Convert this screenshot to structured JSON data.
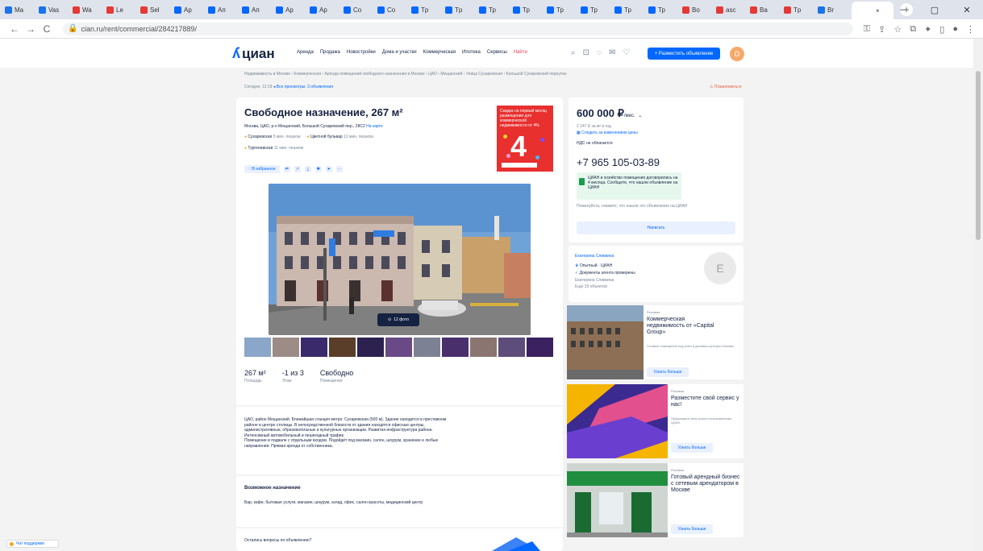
{
  "browser": {
    "tabs": [
      {
        "label": "Ma",
        "color": "#1a73e8"
      },
      {
        "label": "Vas",
        "color": "#1a73e8"
      },
      {
        "label": "Wa",
        "color": "#e53935"
      },
      {
        "label": "Le",
        "color": "#e53935"
      },
      {
        "label": "Sel",
        "color": "#e53935"
      },
      {
        "label": "Ap",
        "color": "#0468ff"
      },
      {
        "label": "Ап",
        "color": "#0468ff"
      },
      {
        "label": "Ап",
        "color": "#0468ff"
      },
      {
        "label": "Ap",
        "color": "#0468ff"
      },
      {
        "label": "Ap",
        "color": "#0468ff"
      },
      {
        "label": "Co",
        "color": "#0468ff"
      },
      {
        "label": "Co",
        "color": "#0468ff"
      },
      {
        "label": "Tp",
        "color": "#0468ff"
      },
      {
        "label": "Tp",
        "color": "#0468ff"
      },
      {
        "label": "Тр",
        "color": "#0468ff"
      },
      {
        "label": "Тр",
        "color": "#0468ff"
      },
      {
        "label": "Тр",
        "color": "#0468ff"
      },
      {
        "label": "Тр",
        "color": "#0468ff"
      },
      {
        "label": "Тр",
        "color": "#0468ff"
      },
      {
        "label": "Тр",
        "color": "#0468ff"
      },
      {
        "label": "Bo",
        "color": "#e53935"
      },
      {
        "label": "asc",
        "color": "#e53935"
      },
      {
        "label": "Ba",
        "color": "#e53935"
      },
      {
        "label": "Tp",
        "color": "#e53935"
      },
      {
        "label": "Br",
        "color": "#1a73e8"
      }
    ],
    "active_tab": "×",
    "new_tab": "+",
    "window_min": "–",
    "window_max": "▢",
    "window_close": "✕",
    "nav_back": "←",
    "nav_forward": "→",
    "nav_reload": "C",
    "url": "cian.ru/rent/commercial/284217889/"
  },
  "site": {
    "logo_text": "циан",
    "nav": [
      "Аренда",
      "Продажа",
      "Новостройки",
      "Дома и участки",
      "Коммерческая",
      "Ипотека",
      "Сервисы",
      "Найти"
    ],
    "post_button": "+ Разместить объявление",
    "avatar_letter": "D",
    "breadcrumbs": "Недвижимость в Москве › Коммерческая › Аренда помещений свободного назначения в Москве › ЦАО › Мещанский › Улица Сухаревская › Большой Сухаревский переулок",
    "updated": "Сегодня, 12:19",
    "back_link": "Все просмотры: 3 объявления",
    "complain": "Пожаловаться"
  },
  "listing": {
    "title": "Свободное назначение, 267 м²",
    "address": "Москва, ЦАО, р-н Мещанский, Большой Сухаревский пер., 28С2",
    "map_link": "На карте",
    "metro": [
      {
        "name": "Сухаревская",
        "time": "5 мин. пешком"
      },
      {
        "name": "Цветной бульвар",
        "time": "12 мин. пешком"
      },
      {
        "name": "Тургеневская",
        "time": "11 мин. пешком"
      }
    ],
    "favorite": "В избранное",
    "promo_text": "Скидка на первый месяц размещения для коммерческой недвижимости от 4%",
    "promo_big": "4",
    "photo_badge": "12 фото",
    "facts": [
      {
        "value": "267 м²",
        "label": "Площадь"
      },
      {
        "value": "-1 из 3",
        "label": "Этаж"
      },
      {
        "value": "Свободно",
        "label": "Помещение"
      }
    ],
    "description": [
      "ЦАО, район Мещанский. Ближайшая станция метро: Сухаревская (500 м). Здание находится в престижном",
      "районе в центре столицы. В непосредственной близости от здания находятся офисные центры,",
      "административные, образовательные и культурные организации. Развитая инфраструктура района.",
      "Интенсивный автомобильный и пешеходный трафик.",
      "Помещение в подвале с отдельным входом. Подойдёт под магазин, салон, шоурум, хранение и любые",
      "направления. Прямая аренда от собственника."
    ],
    "usage_heading": "Возможное назначение",
    "usage_text": "Бар, кафе, бытовые услуги, магазин, шоурум, склад, офис, салон красоты, медицинский центр",
    "question": "Остались вопросы по объявлению?"
  },
  "sidebar": {
    "price": "600 000 ₽",
    "price_unit": "/мес.",
    "price_sub": "2 247 ₽ за м² в год",
    "price_link": "Следить за изменением цены",
    "vat": "НДС не облагается",
    "phone": "+7 965 105-03-89",
    "notice": "ЦИАН и хозяйство помещения договорились на 4 месяца. Сообщите, что нашли объявление на ЦИАН",
    "disclaimer": "Пожалуйста, скажите, что нашли это объявление на ЦИАН",
    "write_button": "Написать",
    "agent_name": "Екатерина Сливкина",
    "agent_status": "Опытный · ЦИАН",
    "agent_docs": "Документы агента проверены",
    "agent_extra": "Екатерина Сливкина",
    "agent_more": "Ещё 19 объектов",
    "agent_avatar": "E",
    "ads": [
      {
        "label": "Реклама",
        "title": "Коммерческая недвижимость от «Capital Group»",
        "sub": "Готовые помещения под ключ в деловых центрах Москвы",
        "button": "Узнать больше"
      },
      {
        "label": "Реклама",
        "title": "Разместите свой сервис у нас!",
        "sub": "Предложите свои услуги пользователям ЦИАН",
        "button": "Узнать больше"
      },
      {
        "label": "Реклама",
        "title": "Готовый арендный бизнес с сетевым арендатором в Москве",
        "sub": "",
        "button": "Узнать больше"
      }
    ]
  },
  "support": "Чат поддержки"
}
